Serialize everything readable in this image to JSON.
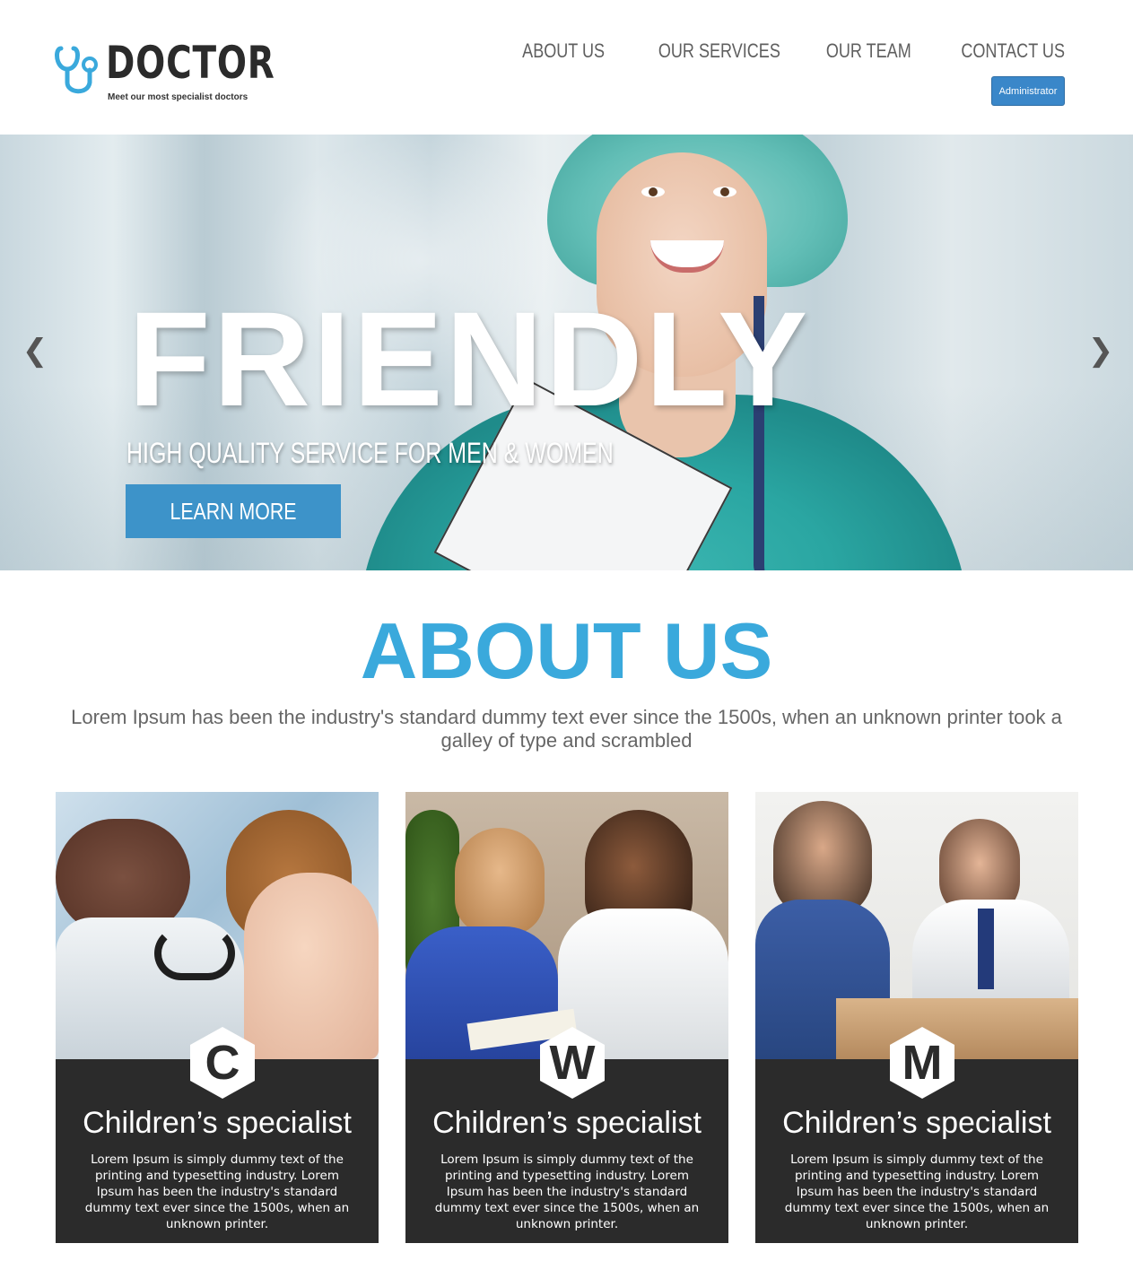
{
  "brand": {
    "name": "DOCTOR",
    "tagline": "Meet our most specialist doctors",
    "accent": "#3aa9dc"
  },
  "nav": {
    "items": [
      {
        "label": "ABOUT US"
      },
      {
        "label": "OUR SERVICES"
      },
      {
        "label": "OUR TEAM"
      },
      {
        "label": "CONTACT US"
      }
    ],
    "admin_label": "Administrator"
  },
  "hero": {
    "title": "FRIENDLY",
    "subtitle": "HIGH QUALITY SERVICE FOR MEN & WOMEN",
    "button_label": "LEARN MORE",
    "prev_icon": "chevron-left-icon",
    "next_icon": "chevron-right-icon"
  },
  "about": {
    "title": "ABOUT US",
    "text": "Lorem Ipsum has been the industry's standard dummy text ever since the 1500s, when an unknown printer took a galley of type and scrambled"
  },
  "cards": [
    {
      "letter": "C",
      "title": "Children’s specialist",
      "text": "Lorem Ipsum is simply dummy text of the printing and typesetting industry. Lorem Ipsum has been the industry's standard dummy text ever since the 1500s, when an unknown printer."
    },
    {
      "letter": "W",
      "title": "Children’s specialist",
      "text": "Lorem Ipsum is simply dummy text of the printing and typesetting industry. Lorem Ipsum has been the industry's standard dummy text ever since the 1500s, when an unknown printer."
    },
    {
      "letter": "M",
      "title": "Children’s specialist",
      "text": "Lorem Ipsum is simply dummy text of the printing and typesetting industry. Lorem Ipsum has been the industry's standard dummy text ever since the 1500s, when an unknown printer."
    }
  ]
}
